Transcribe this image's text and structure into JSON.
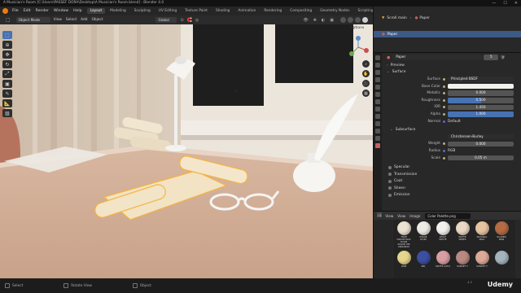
{
  "window": {
    "title": "A Musician's Room [C:\\Users\\PASSEF DORA\\Desktop\\A Musician's Room.blend] - Blender 4.0",
    "controls": [
      "—",
      "☐",
      "✕"
    ]
  },
  "menu": [
    "File",
    "Edit",
    "Render",
    "Window",
    "Help"
  ],
  "workspaces": [
    "Layout",
    "Modeling",
    "Sculpting",
    "UV Editing",
    "Texture Paint",
    "Shading",
    "Animation",
    "Rendering",
    "Compositing",
    "Geometry Nodes",
    "Scripting"
  ],
  "active_workspace": "Layout",
  "scene": "Scene",
  "view_layer": "ViewLayer",
  "viewport": {
    "mode": "Object Mode",
    "menus": [
      "View",
      "Select",
      "Add",
      "Object"
    ],
    "orientation": "Global",
    "options_label": "Options"
  },
  "outliner": {
    "items": [
      {
        "label": "Scroll main",
        "sub": "Paper",
        "selected": false
      },
      {
        "label": "Paper",
        "selected": true
      }
    ]
  },
  "properties": {
    "material_name": "Paper",
    "user_count": "5",
    "sections": {
      "preview": "Preview",
      "surface": "Surface",
      "subsurface": "Subsurface"
    },
    "surface": [
      {
        "label": "Surface",
        "value": "Principled BSDF",
        "kind": "drop"
      },
      {
        "label": "Base Color",
        "value": "",
        "kind": "color"
      },
      {
        "label": "Metallic",
        "value": "0.000",
        "fill": 0.0
      },
      {
        "label": "Roughness",
        "value": "0.500",
        "fill": 0.5
      },
      {
        "label": "IOR",
        "value": "1.450",
        "fill": 0.0
      },
      {
        "label": "Alpha",
        "value": "1.000",
        "fill": 1.0
      },
      {
        "label": "Normal",
        "value": "Default",
        "kind": "plain"
      }
    ],
    "subsurface": [
      {
        "label": "",
        "value": "Christensen-Burley",
        "kind": "drop"
      },
      {
        "label": "Weight",
        "value": "0.000",
        "fill": 0.0
      },
      {
        "label": "Radius",
        "value": "RGB",
        "kind": "plain"
      },
      {
        "label": "Scale",
        "value": "0.05 m"
      }
    ],
    "collapsed": [
      "Specular",
      "Transmission",
      "Coat",
      "Sheen",
      "Emission"
    ]
  },
  "image_editor": {
    "menus": [
      "View",
      "View",
      "Image"
    ],
    "image_name": "Color Palette.png",
    "swatches": [
      {
        "label": "TROP CREAM WAS SOLIN SHADE WE ANGORAS",
        "color": "#ebe2d2"
      },
      {
        "label": "IMAGE IVORY",
        "color": "#ecebe5"
      },
      {
        "label": "WOLF WHITE",
        "color": "#f2f1ee"
      },
      {
        "label": "MATTE WIRES",
        "color": "#e9d8c4"
      },
      {
        "label": "NATURAL MILK",
        "color": "#e7c4a1"
      },
      {
        "label": "SCARED SKIN",
        "color": "#b56c45"
      },
      {
        "label": "LIME",
        "color": "#e6d58d"
      },
      {
        "label": "INK",
        "color": "#3c4fa0"
      },
      {
        "label": "MATTE LOTO",
        "color": "#d99ea3"
      },
      {
        "label": "SUNSET T",
        "color": "#b98a84"
      },
      {
        "label": "SUNSET T",
        "color": "#dcaa99"
      },
      {
        "label": "",
        "color": "#a5b3bd"
      }
    ]
  },
  "status": {
    "items": [
      "Select",
      "Rotate View",
      "Object"
    ],
    "version": "4.0",
    "watermark": "Udemy"
  }
}
